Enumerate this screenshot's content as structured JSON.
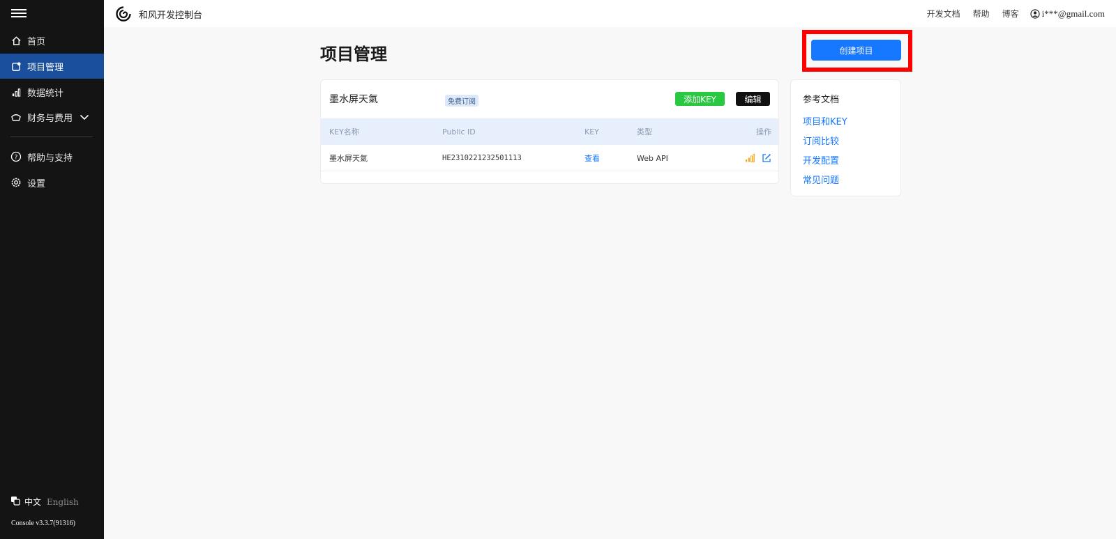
{
  "app": {
    "title": "和风开发控制台"
  },
  "topnav": {
    "links": [
      "开发文档",
      "帮助",
      "博客"
    ],
    "user_email": "i***@gmail.com"
  },
  "sidebar": {
    "items": [
      {
        "label": "首页",
        "icon": "home-icon"
      },
      {
        "label": "项目管理",
        "icon": "project-icon",
        "active": true
      },
      {
        "label": "数据统计",
        "icon": "bar-chart-icon"
      },
      {
        "label": "财务与费用",
        "icon": "wallet-icon",
        "expandable": true
      },
      {
        "label": "帮助与支持",
        "icon": "help-circle-icon"
      },
      {
        "label": "设置",
        "icon": "gear-icon"
      }
    ],
    "lang_zh": "中文",
    "lang_en": "English",
    "version": "Console v3.3.7(91316)"
  },
  "main": {
    "page_title": "项目管理",
    "create_button": "创建项目",
    "project": {
      "name": "墨水屏天氣",
      "plan_badge": "免费订阅",
      "add_key_button": "添加KEY",
      "edit_button": "编辑",
      "columns": [
        "KEY名称",
        "Public ID",
        "KEY",
        "类型",
        "操作"
      ],
      "rows": [
        {
          "key_name": "墨水屏天氣",
          "public_id": "HE2310221232501113",
          "key": "查看",
          "type": "Web API"
        }
      ]
    },
    "ref_docs": {
      "title": "参考文档",
      "links": [
        "项目和KEY",
        "订阅比较",
        "开发配置",
        "常见问题"
      ]
    }
  },
  "colors": {
    "accent": "#1677ff",
    "sidebar_bg": "#141414",
    "active_nav": "#1a4f9e",
    "add_key": "#28c840",
    "highlight": "#ff0000"
  }
}
